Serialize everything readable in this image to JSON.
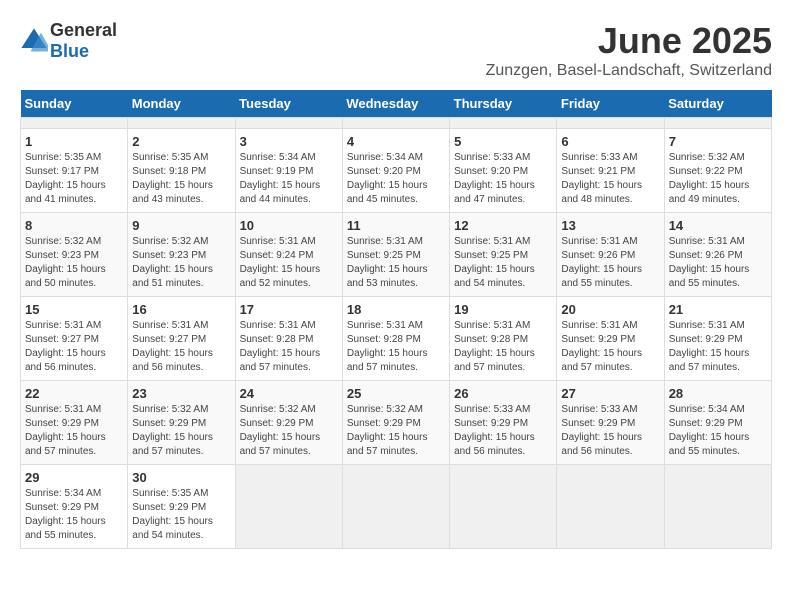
{
  "header": {
    "logo_general": "General",
    "logo_blue": "Blue",
    "title": "June 2025",
    "subtitle": "Zunzgen, Basel-Landschaft, Switzerland"
  },
  "calendar": {
    "days_of_week": [
      "Sunday",
      "Monday",
      "Tuesday",
      "Wednesday",
      "Thursday",
      "Friday",
      "Saturday"
    ],
    "weeks": [
      [
        {
          "day": "",
          "empty": true
        },
        {
          "day": "",
          "empty": true
        },
        {
          "day": "",
          "empty": true
        },
        {
          "day": "",
          "empty": true
        },
        {
          "day": "",
          "empty": true
        },
        {
          "day": "",
          "empty": true
        },
        {
          "day": "",
          "empty": true
        }
      ],
      [
        {
          "day": "1",
          "sunrise": "5:35 AM",
          "sunset": "9:17 PM",
          "daylight": "15 hours and 41 minutes."
        },
        {
          "day": "2",
          "sunrise": "5:35 AM",
          "sunset": "9:18 PM",
          "daylight": "15 hours and 43 minutes."
        },
        {
          "day": "3",
          "sunrise": "5:34 AM",
          "sunset": "9:19 PM",
          "daylight": "15 hours and 44 minutes."
        },
        {
          "day": "4",
          "sunrise": "5:34 AM",
          "sunset": "9:20 PM",
          "daylight": "15 hours and 45 minutes."
        },
        {
          "day": "5",
          "sunrise": "5:33 AM",
          "sunset": "9:20 PM",
          "daylight": "15 hours and 47 minutes."
        },
        {
          "day": "6",
          "sunrise": "5:33 AM",
          "sunset": "9:21 PM",
          "daylight": "15 hours and 48 minutes."
        },
        {
          "day": "7",
          "sunrise": "5:32 AM",
          "sunset": "9:22 PM",
          "daylight": "15 hours and 49 minutes."
        }
      ],
      [
        {
          "day": "8",
          "sunrise": "5:32 AM",
          "sunset": "9:23 PM",
          "daylight": "15 hours and 50 minutes."
        },
        {
          "day": "9",
          "sunrise": "5:32 AM",
          "sunset": "9:23 PM",
          "daylight": "15 hours and 51 minutes."
        },
        {
          "day": "10",
          "sunrise": "5:31 AM",
          "sunset": "9:24 PM",
          "daylight": "15 hours and 52 minutes."
        },
        {
          "day": "11",
          "sunrise": "5:31 AM",
          "sunset": "9:25 PM",
          "daylight": "15 hours and 53 minutes."
        },
        {
          "day": "12",
          "sunrise": "5:31 AM",
          "sunset": "9:25 PM",
          "daylight": "15 hours and 54 minutes."
        },
        {
          "day": "13",
          "sunrise": "5:31 AM",
          "sunset": "9:26 PM",
          "daylight": "15 hours and 55 minutes."
        },
        {
          "day": "14",
          "sunrise": "5:31 AM",
          "sunset": "9:26 PM",
          "daylight": "15 hours and 55 minutes."
        }
      ],
      [
        {
          "day": "15",
          "sunrise": "5:31 AM",
          "sunset": "9:27 PM",
          "daylight": "15 hours and 56 minutes."
        },
        {
          "day": "16",
          "sunrise": "5:31 AM",
          "sunset": "9:27 PM",
          "daylight": "15 hours and 56 minutes."
        },
        {
          "day": "17",
          "sunrise": "5:31 AM",
          "sunset": "9:28 PM",
          "daylight": "15 hours and 57 minutes."
        },
        {
          "day": "18",
          "sunrise": "5:31 AM",
          "sunset": "9:28 PM",
          "daylight": "15 hours and 57 minutes."
        },
        {
          "day": "19",
          "sunrise": "5:31 AM",
          "sunset": "9:28 PM",
          "daylight": "15 hours and 57 minutes."
        },
        {
          "day": "20",
          "sunrise": "5:31 AM",
          "sunset": "9:29 PM",
          "daylight": "15 hours and 57 minutes."
        },
        {
          "day": "21",
          "sunrise": "5:31 AM",
          "sunset": "9:29 PM",
          "daylight": "15 hours and 57 minutes."
        }
      ],
      [
        {
          "day": "22",
          "sunrise": "5:31 AM",
          "sunset": "9:29 PM",
          "daylight": "15 hours and 57 minutes."
        },
        {
          "day": "23",
          "sunrise": "5:32 AM",
          "sunset": "9:29 PM",
          "daylight": "15 hours and 57 minutes."
        },
        {
          "day": "24",
          "sunrise": "5:32 AM",
          "sunset": "9:29 PM",
          "daylight": "15 hours and 57 minutes."
        },
        {
          "day": "25",
          "sunrise": "5:32 AM",
          "sunset": "9:29 PM",
          "daylight": "15 hours and 57 minutes."
        },
        {
          "day": "26",
          "sunrise": "5:33 AM",
          "sunset": "9:29 PM",
          "daylight": "15 hours and 56 minutes."
        },
        {
          "day": "27",
          "sunrise": "5:33 AM",
          "sunset": "9:29 PM",
          "daylight": "15 hours and 56 minutes."
        },
        {
          "day": "28",
          "sunrise": "5:34 AM",
          "sunset": "9:29 PM",
          "daylight": "15 hours and 55 minutes."
        }
      ],
      [
        {
          "day": "29",
          "sunrise": "5:34 AM",
          "sunset": "9:29 PM",
          "daylight": "15 hours and 55 minutes."
        },
        {
          "day": "30",
          "sunrise": "5:35 AM",
          "sunset": "9:29 PM",
          "daylight": "15 hours and 54 minutes."
        },
        {
          "day": "",
          "empty": true
        },
        {
          "day": "",
          "empty": true
        },
        {
          "day": "",
          "empty": true
        },
        {
          "day": "",
          "empty": true
        },
        {
          "day": "",
          "empty": true
        }
      ]
    ]
  }
}
